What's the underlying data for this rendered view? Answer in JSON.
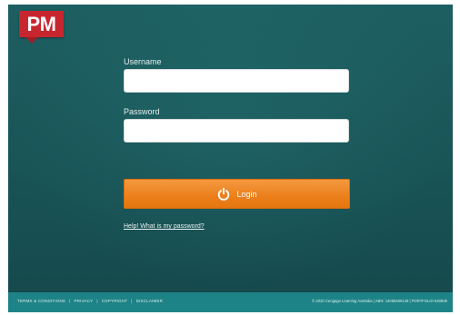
{
  "brand": {
    "logo_text": "PM",
    "colors": {
      "logo": "#c8262f",
      "background": "#1d5f61",
      "accent": "#ec7f1b",
      "footer": "#1e8386"
    }
  },
  "form": {
    "username_label": "Username",
    "username_value": "",
    "password_label": "Password",
    "password_value": "",
    "login_label": "Login",
    "login_icon": "power-icon",
    "help_link": "Help! What is my password?"
  },
  "footer": {
    "links": [
      "TERMS & CONDITIONS",
      "PRIVACY",
      "COPYRIGHT",
      "DISCLAIMER"
    ],
    "separator": "|",
    "copyright": "© 2020 Cengage Learning Australia | ABN: 14058280149 | PORTFOLIO 640836"
  }
}
